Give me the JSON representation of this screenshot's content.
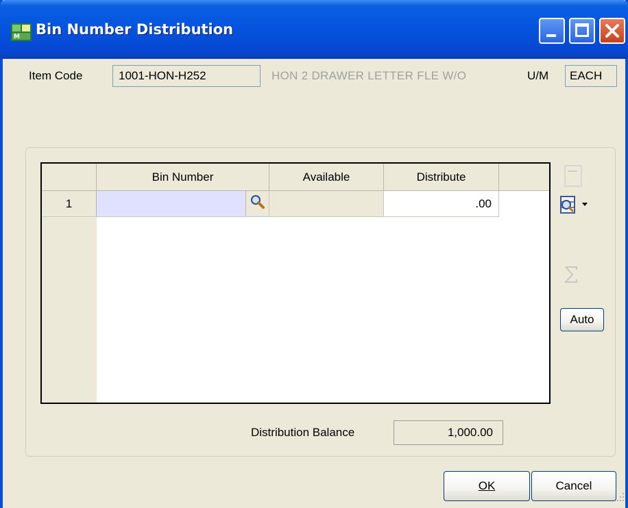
{
  "window": {
    "title": "Bin Number Distribution"
  },
  "item": {
    "code_label": "Item Code",
    "code_value": "1001-HON-H252",
    "description": "HON 2 DRAWER LETTER FLE W/O",
    "um_label": "U/M",
    "um_value": "EACH"
  },
  "grid": {
    "columns": [
      "Bin Number",
      "Available",
      "Distribute"
    ],
    "rows": [
      {
        "row_number": "1",
        "bin_number": "",
        "available": "",
        "distribute": ".00"
      }
    ]
  },
  "side_tools": {
    "auto_label": "Auto"
  },
  "balance": {
    "label": "Distribution Balance",
    "value": "1,000.00"
  },
  "buttons": {
    "ok_label": "OK",
    "cancel_label": "Cancel"
  },
  "colors": {
    "title_bar": "#0554df",
    "window_bg": "#ece9d8",
    "bin_cell_bg": "#e0e0ff"
  }
}
